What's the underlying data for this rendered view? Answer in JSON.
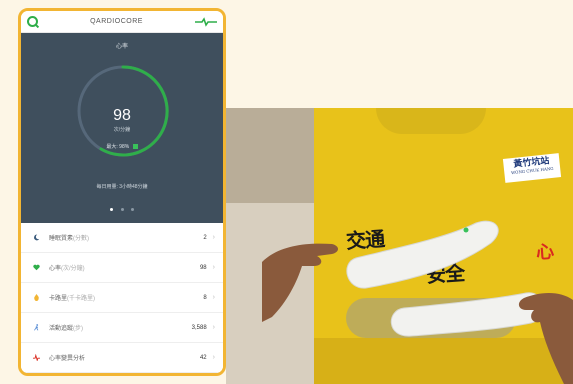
{
  "app": {
    "title": "QARDIOCORE",
    "panel_label": "心率",
    "bpm": "98",
    "bpm_unit": "次/分鐘",
    "max_label": "最大: 98%",
    "summary": "每日用量: 3小時48分鐘",
    "pager_active": 0
  },
  "list": [
    {
      "label": "睡眠質素",
      "sub": "(分數)",
      "value": "2",
      "icon": "moon-icon",
      "color": "#3a5a7c"
    },
    {
      "label": "心率",
      "sub": "(次/分鐘)",
      "value": "98",
      "icon": "heart-icon",
      "color": "#2fae4a"
    },
    {
      "label": "卡路里",
      "sub": "(千卡路里)",
      "value": "8",
      "icon": "flame-icon",
      "color": "#f2b533"
    },
    {
      "label": "活動追蹤",
      "sub": "(步)",
      "value": "3,588",
      "icon": "walk-icon",
      "color": "#5b8fd6"
    },
    {
      "label": "心率變異分析",
      "sub": "",
      "value": "42",
      "icon": "pulse-icon",
      "color": "#d92a1f"
    }
  ],
  "photo": {
    "badge_cn": "黃竹坑站",
    "badge_en": "WONG CHUK HANG",
    "shirt_text_1": "交通",
    "shirt_text_red": "心",
    "shirt_text_2": "安全"
  },
  "colors": {
    "frame": "#f2b533",
    "accent": "#2fae4a",
    "panel": "#3f4f5d",
    "shirt": "#e8c21a"
  }
}
